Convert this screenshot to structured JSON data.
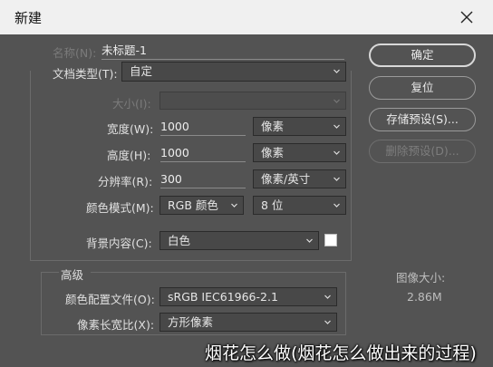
{
  "window": {
    "title": "新建"
  },
  "form": {
    "name_label": "名称(N):",
    "name_value": "未标题-1",
    "doc_type_label": "文档类型(T):",
    "doc_type_value": "自定",
    "size_label": "大小(I):",
    "size_value": "",
    "width_label": "宽度(W):",
    "width_value": "1000",
    "width_unit": "像素",
    "height_label": "高度(H):",
    "height_value": "1000",
    "height_unit": "像素",
    "resolution_label": "分辨率(R):",
    "resolution_value": "300",
    "resolution_unit": "像素/英寸",
    "color_mode_label": "颜色模式(M):",
    "color_mode_value": "RGB 颜色",
    "bit_depth_value": "8 位",
    "background_label": "背景内容(C):",
    "background_value": "白色",
    "background_swatch": "#ffffff"
  },
  "advanced": {
    "title": "高级",
    "profile_label": "颜色配置文件(O):",
    "profile_value": "sRGB IEC61966-2.1",
    "pixel_aspect_label": "像素长宽比(X):",
    "pixel_aspect_value": "方形像素"
  },
  "buttons": {
    "ok": "确定",
    "reset": "复位",
    "save_preset": "存储预设(S)...",
    "delete_preset": "删除预设(D)..."
  },
  "image_size": {
    "label": "图像大小:",
    "value": "2.86M"
  },
  "watermark": "烟花怎么做(烟花怎么做出来的过程)",
  "colors": {
    "dialog_bg": "#535353",
    "titlebar_bg": "#f0f0f0",
    "field_bg": "#3d3d3d"
  }
}
